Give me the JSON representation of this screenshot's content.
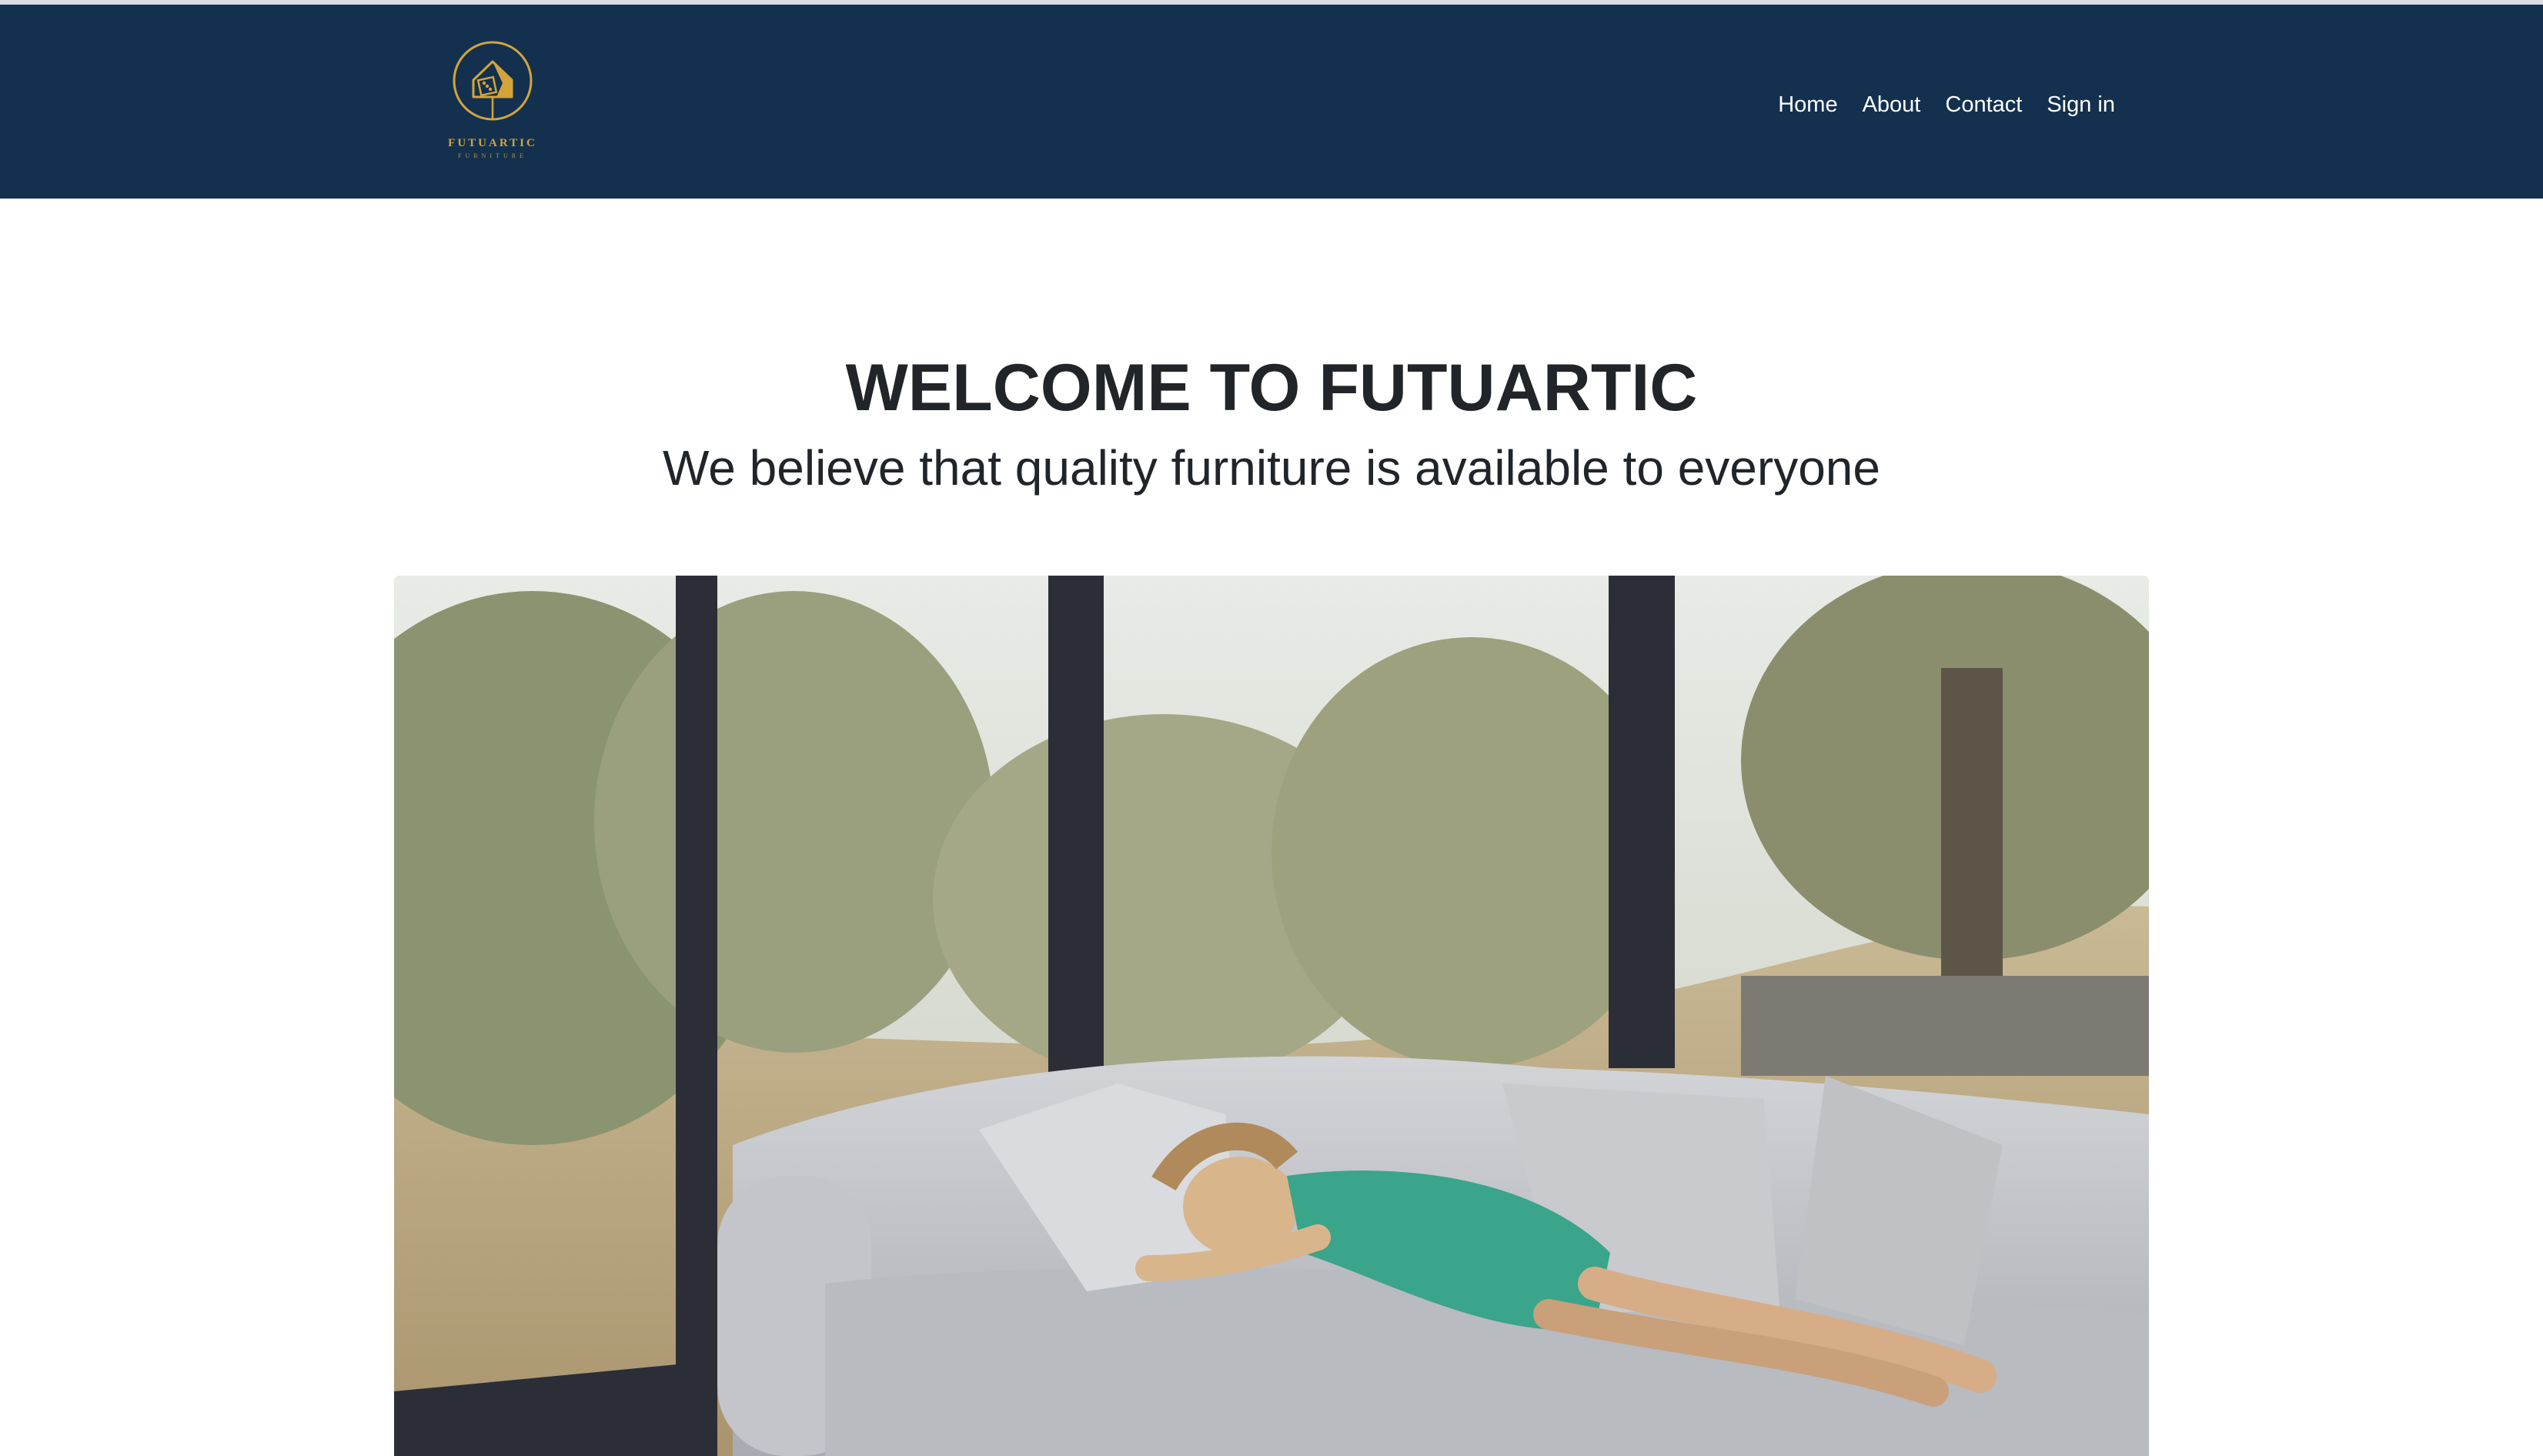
{
  "brand": {
    "name": "FUTUARTIC",
    "tagline": "FURNITURE",
    "logo_icon": "house-logo-icon",
    "primary_color": "#13314f",
    "accent_color": "#d4a43a"
  },
  "nav": {
    "items": [
      {
        "label": "Home"
      },
      {
        "label": "About"
      },
      {
        "label": "Contact"
      },
      {
        "label": "Sign in"
      }
    ]
  },
  "hero": {
    "title": "WELCOME TO FUTUARTIC",
    "subtitle": "We believe that quality furniture is available to everyone",
    "image_subject": "woman-sleeping-on-sofa-photo"
  }
}
